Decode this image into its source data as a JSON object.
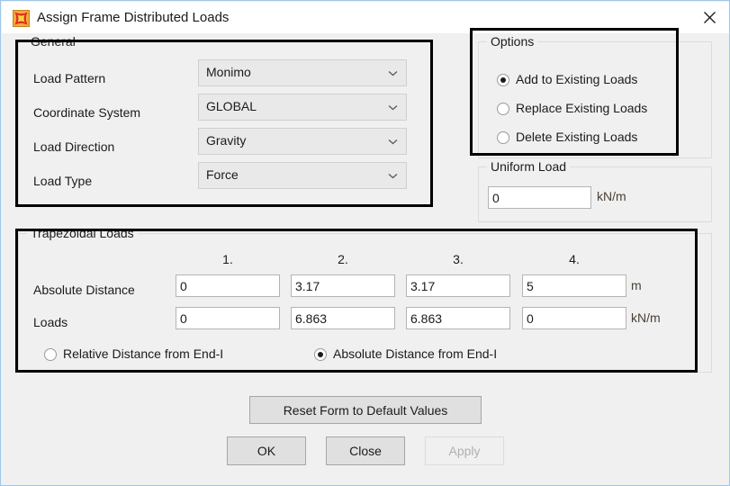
{
  "window": {
    "title": "Assign Frame Distributed Loads",
    "icon": "sap2000-star-icon",
    "close_label": "✕",
    "border_color": "#9fc7e8",
    "face_color": "#f0f0f0"
  },
  "general": {
    "legend": "General",
    "rows": [
      {
        "label": "Load Pattern",
        "value": "Monimo"
      },
      {
        "label": "Coordinate System",
        "value": "GLOBAL"
      },
      {
        "label": "Load Direction",
        "value": "Gravity"
      },
      {
        "label": "Load Type",
        "value": "Force"
      }
    ]
  },
  "options": {
    "legend": "Options",
    "items": [
      {
        "label": "Add to Existing Loads",
        "selected": true
      },
      {
        "label": "Replace Existing Loads",
        "selected": false
      },
      {
        "label": "Delete Existing Loads",
        "selected": false
      }
    ]
  },
  "uniform_load": {
    "legend": "Uniform Load",
    "value": "0",
    "unit": "kN/m"
  },
  "trapezoidal": {
    "legend": "Trapezoidal Loads",
    "column_headers": [
      "1.",
      "2.",
      "3.",
      "4."
    ],
    "distance_label": "Absolute Distance",
    "distance_values": [
      "0",
      "3.17",
      "3.17",
      "5"
    ],
    "distance_unit": "m",
    "loads_label": "Loads",
    "loads_values": [
      "0",
      "6.863",
      "6.863",
      "0"
    ],
    "loads_unit": "kN/m",
    "distance_mode": [
      {
        "label": "Relative Distance from End-I",
        "selected": false
      },
      {
        "label": "Absolute Distance from End-I",
        "selected": true
      }
    ]
  },
  "buttons": {
    "reset": "Reset Form to Default Values",
    "ok": "OK",
    "close": "Close",
    "apply": "Apply",
    "apply_enabled": false
  }
}
